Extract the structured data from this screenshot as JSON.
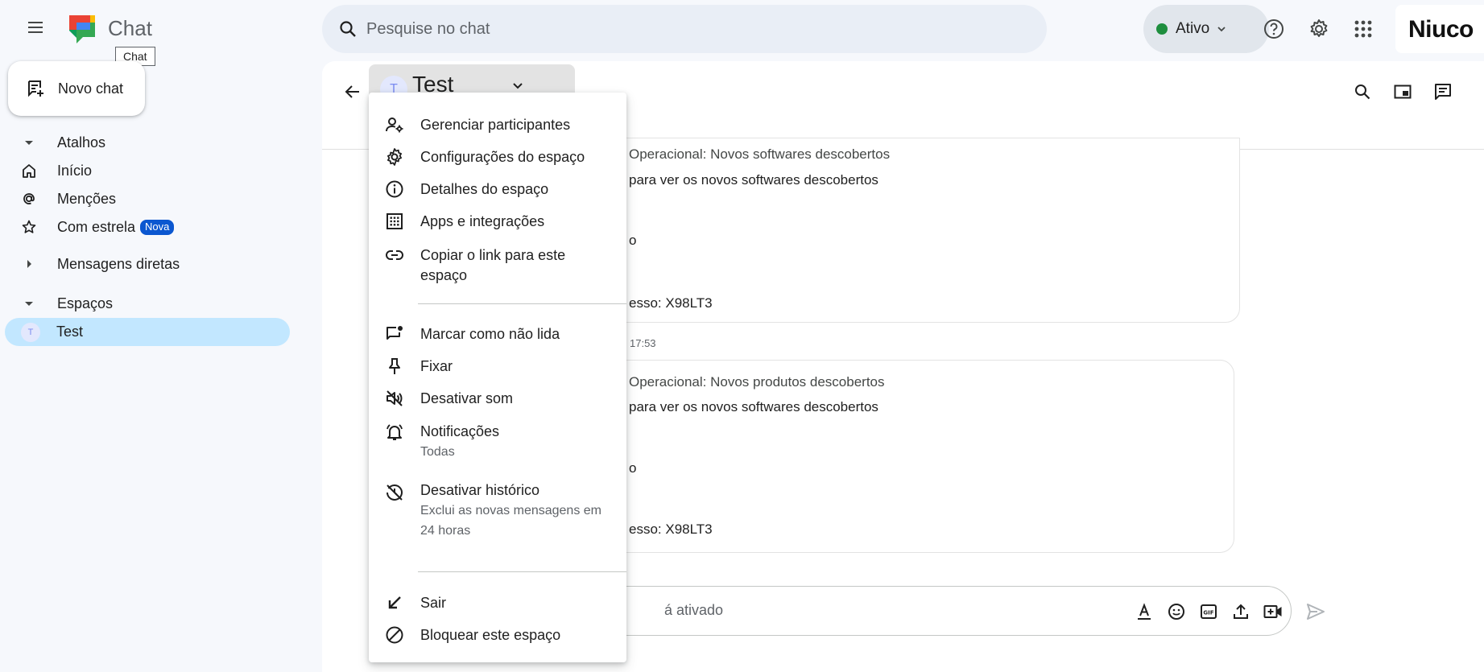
{
  "app": {
    "title": "Chat",
    "tooltip": "Chat",
    "brand": "Niuco"
  },
  "search": {
    "placeholder": "Pesquise no chat"
  },
  "status": {
    "label": "Ativo",
    "color": "#1e8e3e"
  },
  "sidebar": {
    "new_chat_label": "Novo chat",
    "shortcuts_label": "Atalhos",
    "items": [
      {
        "label": "Início",
        "icon": "home-icon"
      },
      {
        "label": "Menções",
        "icon": "at-icon"
      },
      {
        "label": "Com estrela",
        "icon": "star-icon",
        "badge": "Nova"
      }
    ],
    "direct_messages_label": "Mensagens diretas",
    "spaces_label": "Espaços",
    "spaces": [
      {
        "name": "Test",
        "avatar": "T",
        "active": true
      }
    ]
  },
  "conversation": {
    "title": "Test",
    "avatar": "T",
    "messages": [
      {
        "lines": [
          "Operacional: Novos softwares descobertos",
          "para ver os novos softwares descobertos",
          "o",
          "esso: X98LT3"
        ]
      },
      {
        "time": "17:53",
        "lines": [
          "Operacional: Novos produtos descobertos",
          "para ver os novos softwares descobertos",
          "o",
          "esso: X98LT3"
        ]
      }
    ],
    "composer_placeholder": "á ativado"
  },
  "menu": {
    "items": [
      {
        "label": "Gerenciar participantes",
        "icon": "manage-people-icon"
      },
      {
        "label": "Configurações do espaço",
        "icon": "settings-icon"
      },
      {
        "label": "Detalhes do espaço",
        "icon": "info-icon"
      },
      {
        "label": "Apps e integrações",
        "icon": "apps-grid-icon"
      },
      {
        "label": "Copiar o link para este espaço",
        "icon": "link-icon"
      },
      {
        "label": "Marcar como não lida",
        "icon": "mark-unread-icon"
      },
      {
        "label": "Fixar",
        "icon": "pin-icon"
      },
      {
        "label": "Desativar som",
        "icon": "mute-icon"
      },
      {
        "label": "Notificações",
        "sub": "Todas",
        "icon": "notifications-icon"
      },
      {
        "label": "Desativar histórico",
        "sub": "Exclui as novas mensagens em 24 horas",
        "icon": "history-off-icon"
      },
      {
        "label": "Sair",
        "icon": "leave-icon"
      },
      {
        "label": "Bloquear este espaço",
        "icon": "block-icon"
      }
    ]
  }
}
